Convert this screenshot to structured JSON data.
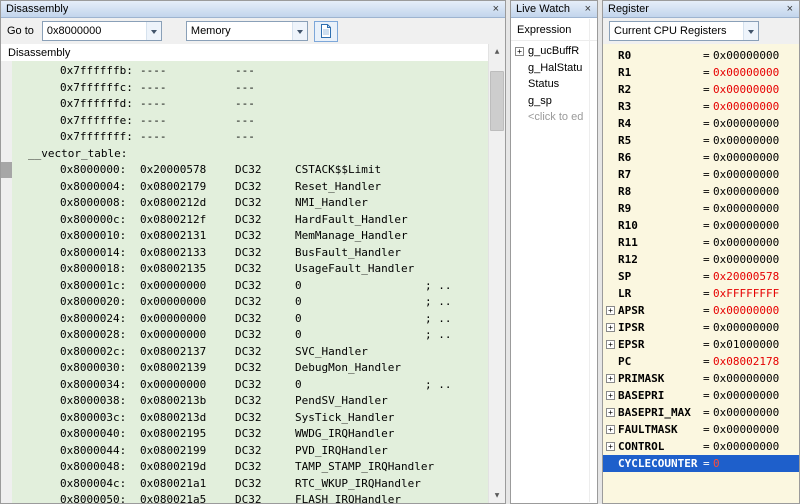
{
  "colors": {
    "changed": "#e60000",
    "selection_bg": "#1e5fcb",
    "disasm_bg": "#e2efdc",
    "register_bg": "#fbf7e0",
    "titlebar_top": "#e6eef9",
    "titlebar_bottom": "#c2d5ec"
  },
  "disassembly": {
    "title": "Disassembly",
    "toolbar": {
      "goto_label": "Go to",
      "goto_value": "0x8000000",
      "view_value": "Memory"
    },
    "content_title": "Disassembly",
    "lines": [
      {
        "addr": "0x7ffffffb:",
        "code": "----",
        "op": "---",
        "operand": "",
        "comment": ""
      },
      {
        "addr": "0x7ffffffc:",
        "code": "----",
        "op": "---",
        "operand": "",
        "comment": ""
      },
      {
        "addr": "0x7ffffffd:",
        "code": "----",
        "op": "---",
        "operand": "",
        "comment": ""
      },
      {
        "addr": "0x7ffffffe:",
        "code": "----",
        "op": "---",
        "operand": "",
        "comment": ""
      },
      {
        "addr": "0x7fffffff:",
        "code": "----",
        "op": "---",
        "operand": "",
        "comment": ""
      },
      {
        "label": "__vector_table:"
      },
      {
        "addr": "0x8000000:",
        "code": "0x20000578",
        "op": "DC32",
        "operand": "CSTACK$$Limit",
        "comment": "",
        "marker": true
      },
      {
        "addr": "0x8000004:",
        "code": "0x08002179",
        "op": "DC32",
        "operand": "Reset_Handler",
        "comment": ""
      },
      {
        "addr": "0x8000008:",
        "code": "0x0800212d",
        "op": "DC32",
        "operand": "NMI_Handler",
        "comment": ""
      },
      {
        "addr": "0x800000c:",
        "code": "0x0800212f",
        "op": "DC32",
        "operand": "HardFault_Handler",
        "comment": ""
      },
      {
        "addr": "0x8000010:",
        "code": "0x08002131",
        "op": "DC32",
        "operand": "MemManage_Handler",
        "comment": ""
      },
      {
        "addr": "0x8000014:",
        "code": "0x08002133",
        "op": "DC32",
        "operand": "BusFault_Handler",
        "comment": ""
      },
      {
        "addr": "0x8000018:",
        "code": "0x08002135",
        "op": "DC32",
        "operand": "UsageFault_Handler",
        "comment": ""
      },
      {
        "addr": "0x800001c:",
        "code": "0x00000000",
        "op": "DC32",
        "operand": "0",
        "comment": "; .."
      },
      {
        "addr": "0x8000020:",
        "code": "0x00000000",
        "op": "DC32",
        "operand": "0",
        "comment": "; .."
      },
      {
        "addr": "0x8000024:",
        "code": "0x00000000",
        "op": "DC32",
        "operand": "0",
        "comment": "; .."
      },
      {
        "addr": "0x8000028:",
        "code": "0x00000000",
        "op": "DC32",
        "operand": "0",
        "comment": "; .."
      },
      {
        "addr": "0x800002c:",
        "code": "0x08002137",
        "op": "DC32",
        "operand": "SVC_Handler",
        "comment": ""
      },
      {
        "addr": "0x8000030:",
        "code": "0x08002139",
        "op": "DC32",
        "operand": "DebugMon_Handler",
        "comment": ""
      },
      {
        "addr": "0x8000034:",
        "code": "0x00000000",
        "op": "DC32",
        "operand": "0",
        "comment": "; .."
      },
      {
        "addr": "0x8000038:",
        "code": "0x0800213b",
        "op": "DC32",
        "operand": "PendSV_Handler",
        "comment": ""
      },
      {
        "addr": "0x800003c:",
        "code": "0x0800213d",
        "op": "DC32",
        "operand": "SysTick_Handler",
        "comment": ""
      },
      {
        "addr": "0x8000040:",
        "code": "0x08002195",
        "op": "DC32",
        "operand": "WWDG_IRQHandler",
        "comment": ""
      },
      {
        "addr": "0x8000044:",
        "code": "0x08002199",
        "op": "DC32",
        "operand": "PVD_IRQHandler",
        "comment": ""
      },
      {
        "addr": "0x8000048:",
        "code": "0x0800219d",
        "op": "DC32",
        "operand": "TAMP_STAMP_IRQHandler",
        "comment": ""
      },
      {
        "addr": "0x800004c:",
        "code": "0x080021a1",
        "op": "DC32",
        "operand": "RTC_WKUP_IRQHandler",
        "comment": ""
      },
      {
        "addr": "0x8000050:",
        "code": "0x080021a5",
        "op": "DC32",
        "operand": "FLASH_IRQHandler",
        "comment": ""
      }
    ]
  },
  "live_watch": {
    "title": "Live Watch",
    "column_header": "Expression",
    "items": [
      {
        "label": "g_ucBuffR",
        "expandable": true,
        "placeholder": false
      },
      {
        "label": "g_HalStatu",
        "expandable": false,
        "placeholder": false
      },
      {
        "label": "Status",
        "expandable": false,
        "placeholder": false
      },
      {
        "label": "g_sp",
        "expandable": false,
        "placeholder": false
      },
      {
        "label": "<click to ed",
        "expandable": false,
        "placeholder": true
      }
    ]
  },
  "register": {
    "title": "Register",
    "selector_value": "Current CPU Registers",
    "rows": [
      {
        "name": "R0",
        "value": "0x00000000",
        "changed": false,
        "expandable": false,
        "selected": false
      },
      {
        "name": "R1",
        "value": "0x00000000",
        "changed": true,
        "expandable": false,
        "selected": false
      },
      {
        "name": "R2",
        "value": "0x00000000",
        "changed": true,
        "expandable": false,
        "selected": false
      },
      {
        "name": "R3",
        "value": "0x00000000",
        "changed": true,
        "expandable": false,
        "selected": false
      },
      {
        "name": "R4",
        "value": "0x00000000",
        "changed": false,
        "expandable": false,
        "selected": false
      },
      {
        "name": "R5",
        "value": "0x00000000",
        "changed": false,
        "expandable": false,
        "selected": false
      },
      {
        "name": "R6",
        "value": "0x00000000",
        "changed": false,
        "expandable": false,
        "selected": false
      },
      {
        "name": "R7",
        "value": "0x00000000",
        "changed": false,
        "expandable": false,
        "selected": false
      },
      {
        "name": "R8",
        "value": "0x00000000",
        "changed": false,
        "expandable": false,
        "selected": false
      },
      {
        "name": "R9",
        "value": "0x00000000",
        "changed": false,
        "expandable": false,
        "selected": false
      },
      {
        "name": "R10",
        "value": "0x00000000",
        "changed": false,
        "expandable": false,
        "selected": false
      },
      {
        "name": "R11",
        "value": "0x00000000",
        "changed": false,
        "expandable": false,
        "selected": false
      },
      {
        "name": "R12",
        "value": "0x00000000",
        "changed": false,
        "expandable": false,
        "selected": false
      },
      {
        "name": "SP",
        "value": "0x20000578",
        "changed": true,
        "expandable": false,
        "selected": false
      },
      {
        "name": "LR",
        "value": "0xFFFFFFFF",
        "changed": true,
        "expandable": false,
        "selected": false
      },
      {
        "name": "APSR",
        "value": "0x00000000",
        "changed": true,
        "expandable": true,
        "selected": false
      },
      {
        "name": "IPSR",
        "value": "0x00000000",
        "changed": false,
        "expandable": true,
        "selected": false
      },
      {
        "name": "EPSR",
        "value": "0x01000000",
        "changed": false,
        "expandable": true,
        "selected": false
      },
      {
        "name": "PC",
        "value": "0x08002178",
        "changed": true,
        "expandable": false,
        "selected": false
      },
      {
        "name": "PRIMASK",
        "value": "0x00000000",
        "changed": false,
        "expandable": true,
        "selected": false
      },
      {
        "name": "BASEPRI",
        "value": "0x00000000",
        "changed": false,
        "expandable": true,
        "selected": false
      },
      {
        "name": "BASEPRI_MAX",
        "value": "0x00000000",
        "changed": false,
        "expandable": true,
        "selected": false
      },
      {
        "name": "FAULTMASK",
        "value": "0x00000000",
        "changed": false,
        "expandable": true,
        "selected": false
      },
      {
        "name": "CONTROL",
        "value": "0x00000000",
        "changed": false,
        "expandable": true,
        "selected": false
      },
      {
        "name": "CYCLECOUNTER",
        "value": "0",
        "changed": true,
        "expandable": false,
        "selected": true
      }
    ]
  }
}
